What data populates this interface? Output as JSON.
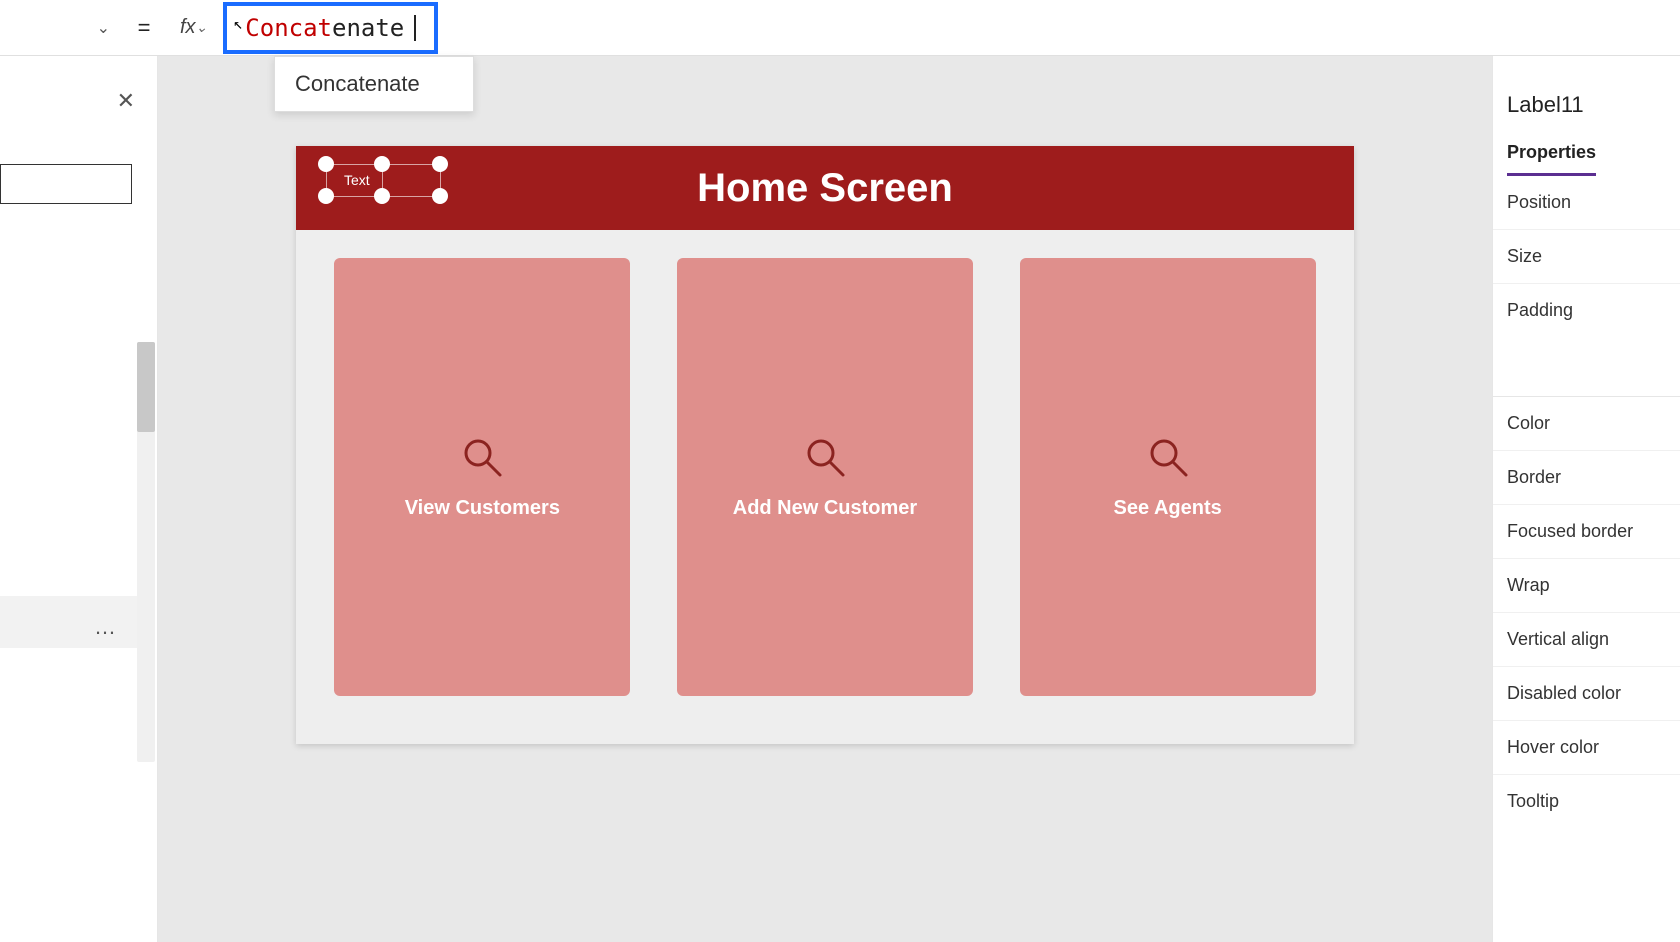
{
  "formula": {
    "prefix_text": "Concat",
    "rest_text": "enate",
    "suggestion": "Concatenate",
    "equals": "=",
    "fx": "fx"
  },
  "left": {
    "more": "…",
    "close": "✕"
  },
  "screen": {
    "title": "Home Screen",
    "selected_label_text": "Text",
    "cards": [
      {
        "label": "View Customers"
      },
      {
        "label": "Add New Customer"
      },
      {
        "label": "See Agents"
      }
    ]
  },
  "right": {
    "control_name": "Label11",
    "tab": "Properties",
    "items": {
      "position": "Position",
      "size": "Size",
      "padding": "Padding",
      "color": "Color",
      "border": "Border",
      "focused_border": "Focused border",
      "wrap": "Wrap",
      "valign": "Vertical align",
      "disabled_color": "Disabled color",
      "hover_color": "Hover color",
      "tooltip": "Tooltip"
    }
  }
}
